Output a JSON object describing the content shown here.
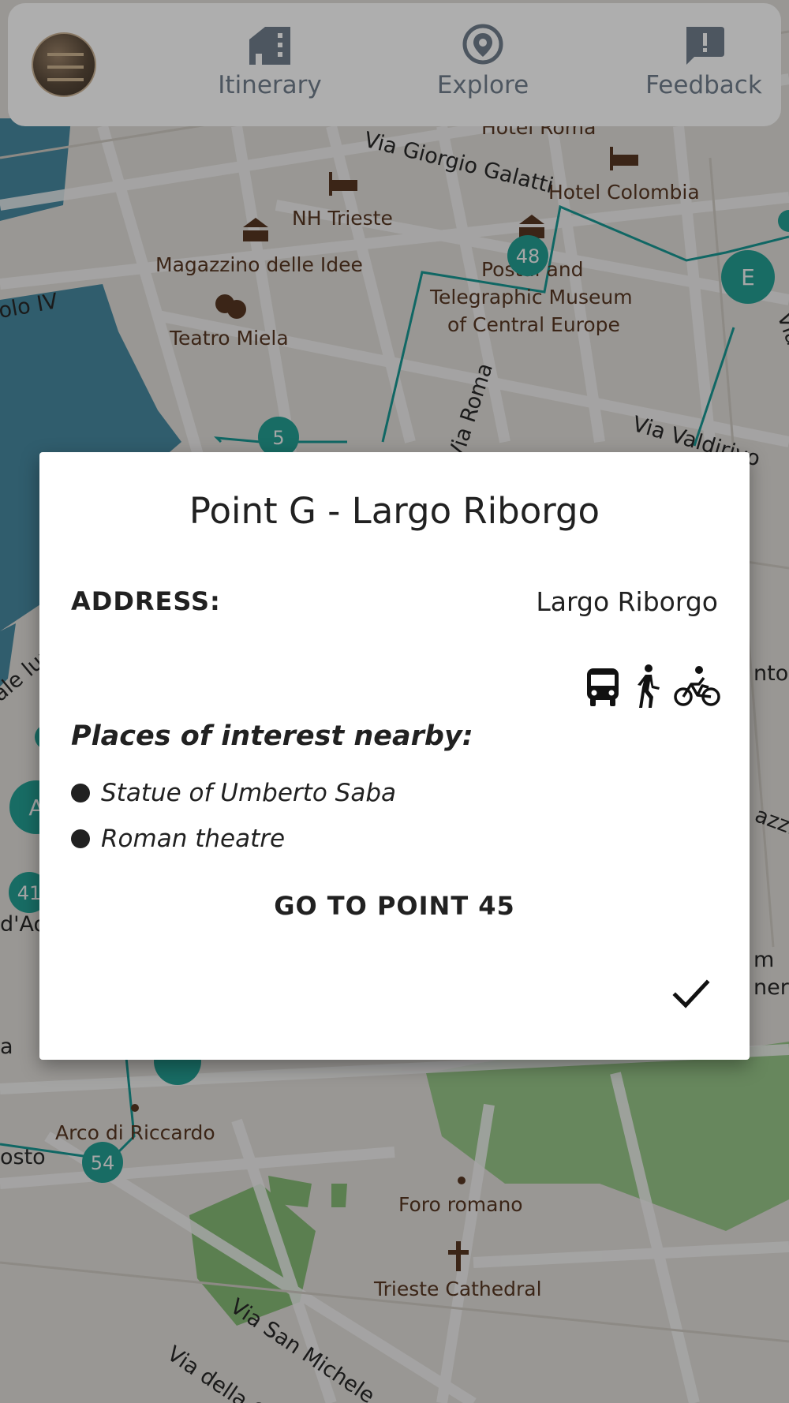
{
  "nav": {
    "items": [
      {
        "label": "Itinerary",
        "icon": "building-icon"
      },
      {
        "label": "Explore",
        "icon": "location-pin-icon"
      },
      {
        "label": "Feedback",
        "icon": "feedback-icon"
      }
    ]
  },
  "map": {
    "places": {
      "hotel_roma": "Hotel Roma",
      "hotel_colombia": "Hotel Colombia",
      "nh_trieste": "NH Trieste",
      "magazzino": "Magazzino delle Idee",
      "teatro": "Teatro Miela",
      "museum_1": "Postal and",
      "museum_2": "Telegraphic Museum",
      "museum_3": "of Central Europe",
      "arco": "Arco di Riccardo",
      "foro": "Foro romano",
      "cathedral": "Trieste Cathedral"
    },
    "streets": {
      "galatti": "Via Giorgio Galatti",
      "roma": "Via Roma",
      "valdirivo": "Via Valdirivo",
      "san_michele": "Via San Michele",
      "della": "Via della G",
      "molo": "olo IV",
      "lungomare": "ale lun",
      "antoni": "ntoni",
      "mazzini": "azzin",
      "daosta": "d'Ao",
      "costo": "osto",
      "em": "m",
      "ner": "ner",
      "a": "a",
      "via_right": "Via"
    },
    "markers": [
      "48",
      "5",
      "E",
      "A",
      "41",
      "54"
    ]
  },
  "dialog": {
    "title": "Point G - Largo Riborgo",
    "address_label": "ADDRESS:",
    "address_value": "Largo Riborgo",
    "transport_icons": [
      "bus-icon",
      "walk-icon",
      "bike-icon"
    ],
    "poi_heading": "Places of interest nearby:",
    "poi": [
      "Statue of Umberto Saba",
      "Roman theatre"
    ],
    "goto_label": "GO TO POINT 45",
    "confirm_icon": "check-icon"
  },
  "colors": {
    "route": "#1a9e9a",
    "marker": "#26a69a",
    "water": "#4a90a8",
    "park": "#7ab36b"
  }
}
